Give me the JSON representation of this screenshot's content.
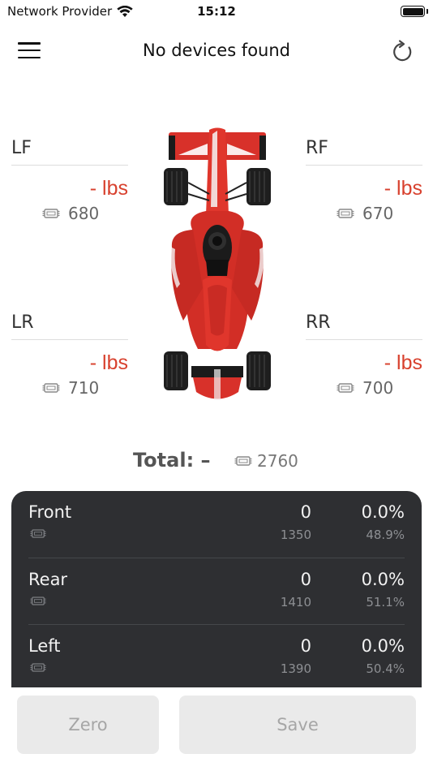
{
  "status_bar": {
    "carrier": "Network Provider",
    "time": "15:12",
    "battery_level": 1.0
  },
  "nav": {
    "title": "No devices found",
    "left_icon": "hamburger-menu-icon",
    "right_icon": "refresh-icon"
  },
  "corners": {
    "lf": {
      "label": "LF",
      "weight": "- lbs",
      "sensor": "680"
    },
    "rf": {
      "label": "RF",
      "weight": "- lbs",
      "sensor": "670"
    },
    "lr": {
      "label": "LR",
      "weight": "- lbs",
      "sensor": "710"
    },
    "rr": {
      "label": "RR",
      "weight": "- lbs",
      "sensor": "700"
    }
  },
  "total": {
    "label": "Total: –",
    "sensor": "2760"
  },
  "distribution": [
    {
      "name": "Front",
      "value": "0",
      "percent": "0.0%",
      "sensor_value": "1350",
      "sensor_percent": "48.9%"
    },
    {
      "name": "Rear",
      "value": "0",
      "percent": "0.0%",
      "sensor_value": "1410",
      "sensor_percent": "51.1%"
    },
    {
      "name": "Left",
      "value": "0",
      "percent": "0.0%",
      "sensor_value": "1390",
      "sensor_percent": "50.4%"
    }
  ],
  "buttons": {
    "zero": "Zero",
    "save": "Save"
  },
  "colors": {
    "accent_red": "#d8412e",
    "panel_dark": "#2e2f32",
    "button_disabled": "#eaeaea"
  }
}
